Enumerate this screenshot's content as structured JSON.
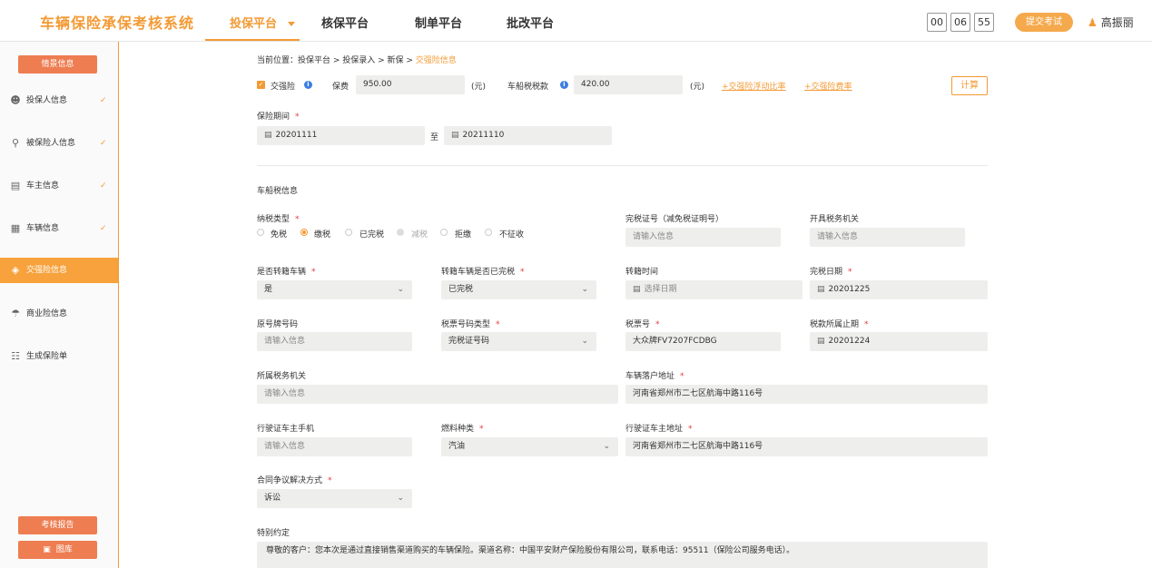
{
  "header": {
    "app_title": "车辆保险承保考核系统",
    "nav": [
      "投保平台",
      "核保平台",
      "制单平台",
      "批改平台"
    ],
    "timer": [
      "00",
      "06",
      "55"
    ],
    "submit_label": "提交考试",
    "user_name": "高振丽"
  },
  "sidebar": {
    "top_button": "情景信息",
    "items": [
      {
        "label": "投保人信息",
        "icon": "person-icon"
      },
      {
        "label": "被保险人信息",
        "icon": "person-search-icon"
      },
      {
        "label": "车主信息",
        "icon": "id-card-icon"
      },
      {
        "label": "车辆信息",
        "icon": "car-doc-icon"
      },
      {
        "label": "交强险信息",
        "icon": "shield-icon"
      },
      {
        "label": "商业险信息",
        "icon": "umbrella-icon"
      },
      {
        "label": "生成保险单",
        "icon": "clipboard-icon"
      }
    ],
    "report_button": "考核报告",
    "gallery_button": "图库"
  },
  "breadcrumb": {
    "prefix": "当前位置：投保平台 > 投保录入 > 新保 > ",
    "current": "交强险信息"
  },
  "premium": {
    "checkbox_label": "交强险",
    "fee_label": "保费",
    "fee_value": "950.00",
    "unit": "(元)",
    "tax_label": "车船税税款",
    "tax_value": "420.00",
    "link_float": "+交强险浮动比率",
    "link_rate": "+交强险费率",
    "calc_label": "计算"
  },
  "period": {
    "label": "保险期间",
    "start": "20201111",
    "to": "至",
    "end": "20211110"
  },
  "tax_section": {
    "title": "车船税信息",
    "tax_type_label": "纳税类型",
    "tax_type_options": [
      "免税",
      "缴税",
      "已完税",
      "减税",
      "拒缴",
      "不征收"
    ],
    "paid_cert_label": "完税证号（减免税证明号）",
    "paid_cert_placeholder": "请输入信息",
    "issuer_label": "开具税务机关",
    "issuer_placeholder": "请输入信息",
    "transfer_label": "是否转籍车辆",
    "transfer_value": "是",
    "transfer_paid_label": "转籍车辆是否已完税",
    "transfer_paid_value": "已完税",
    "transfer_time_label": "转籍时间",
    "transfer_time_placeholder": "选择日期",
    "paid_date_label": "完税日期",
    "paid_date_value": "20201225",
    "orig_plate_label": "原号牌号码",
    "orig_plate_placeholder": "请输入信息",
    "ticket_type_label": "税票号码类型",
    "ticket_type_value": "完税证号码",
    "ticket_no_label": "税票号",
    "ticket_no_value": "大众牌FV7207FCDBG",
    "tax_end_label": "税款所属止期",
    "tax_end_value": "20201224",
    "tax_office_label": "所属税务机关",
    "tax_office_placeholder": "请输入信息",
    "vehicle_addr_label": "车辆落户地址",
    "vehicle_addr_value": "河南省郑州市二七区航海中路116号",
    "owner_phone_label": "行驶证车主手机",
    "owner_phone_placeholder": "请输入信息",
    "fuel_label": "燃料种类",
    "fuel_value": "汽油",
    "owner_addr_label": "行驶证车主地址",
    "owner_addr_value": "河南省郑州市二七区航海中路116号",
    "dispute_label": "合同争议解决方式",
    "dispute_value": "诉讼",
    "special_label": "特别约定",
    "special_value": "尊敬的客户：您本次是通过直接销售渠道购买的车辆保险。渠道名称：中国平安财产保险股份有限公司，联系电话：95511（保险公司服务电话）。"
  },
  "colors": {
    "accent": "#f39a34",
    "side_button": "#ee7d51",
    "required": "#e4393c"
  }
}
